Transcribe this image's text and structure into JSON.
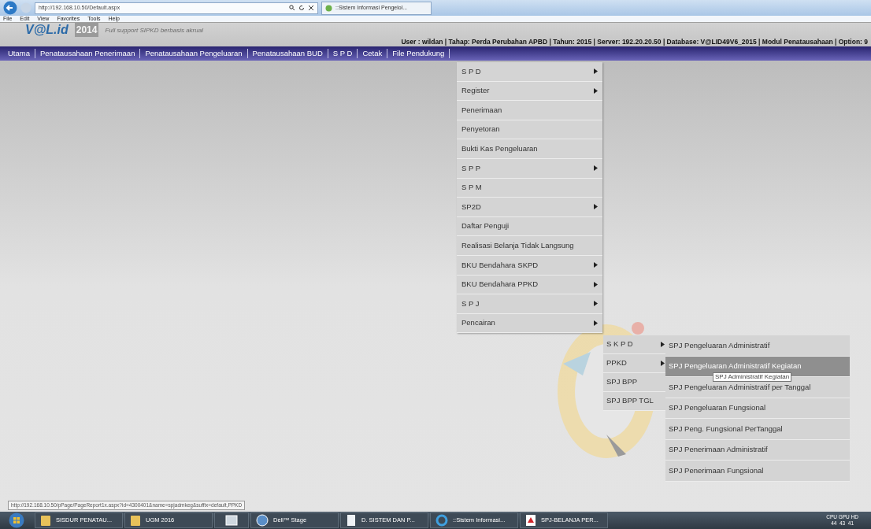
{
  "browser": {
    "address": "http://192.168.10.50/Default.aspx",
    "tab_title": "::Sistem Informasi Pengelol...",
    "menu": [
      "File",
      "Edit",
      "View",
      "Favorites",
      "Tools",
      "Help"
    ]
  },
  "header": {
    "logo": "V@L.id",
    "logo_year": "2014",
    "tagline": "Full support SIPKD berbasis akrual",
    "info": "User : wildan | Tahap: Perda Perubahan APBD | Tahun: 2015 | Server: 192.20.20.50 | Database: V@LID49V6_2015 | Modul Penatausahaan | Option: 9"
  },
  "nav": [
    "Utama",
    "Penatausahaan Penerimaan",
    "Penatausahaan Pengeluaran",
    "Penatausahaan BUD",
    "S P D",
    "Cetak",
    "File Pendukung"
  ],
  "menu": [
    {
      "label": "S P D",
      "has_submenu": true
    },
    {
      "label": "Register",
      "has_submenu": true
    },
    {
      "label": "Penerimaan",
      "has_submenu": false
    },
    {
      "label": "Penyetoran",
      "has_submenu": false
    },
    {
      "label": "Bukti Kas Pengeluaran",
      "has_submenu": false
    },
    {
      "label": "S P P",
      "has_submenu": true
    },
    {
      "label": "S P M",
      "has_submenu": false
    },
    {
      "label": "SP2D",
      "has_submenu": true
    },
    {
      "label": "Daftar Penguji",
      "has_submenu": false
    },
    {
      "label": "Realisasi Belanja Tidak Langsung",
      "has_submenu": false
    },
    {
      "label": "BKU Bendahara SKPD",
      "has_submenu": true
    },
    {
      "label": "BKU Bendahara PPKD",
      "has_submenu": true
    },
    {
      "label": "S P J",
      "has_submenu": true
    },
    {
      "label": "Pencairan",
      "has_submenu": true
    }
  ],
  "submenu": [
    {
      "label": "S K P D",
      "has_submenu": true
    },
    {
      "label": "PPKD",
      "has_submenu": true
    },
    {
      "label": "SPJ BPP",
      "has_submenu": false
    },
    {
      "label": "SPJ BPP TGL",
      "has_submenu": false
    }
  ],
  "submenu_2": [
    {
      "label": "SPJ Pengeluaran Administratif",
      "highlighted": false
    },
    {
      "label": "SPJ Pengeluaran Administratif Kegiatan",
      "highlighted": true
    },
    {
      "label": "SPJ Pengeluaran Administratif per Tanggal",
      "highlighted": false
    },
    {
      "label": "SPJ Pengeluaran Fungsional",
      "highlighted": false
    },
    {
      "label": "SPJ Peng. Fungsional PerTanggal",
      "highlighted": false
    },
    {
      "label": "SPJ Penerimaan Administratif",
      "highlighted": false
    },
    {
      "label": "SPJ Penerimaan Fungsional",
      "highlighted": false
    }
  ],
  "tooltip": "SPJ Administratif Kegiatan",
  "status_url": "http://192.168.10.50/pPage/PageReport1x.aspx?id=4300401&name=spjadmkeg&suffix=default,PPKD",
  "taskbar": [
    {
      "kind": "folder",
      "label": "SISDUR PENATAU..."
    },
    {
      "kind": "folder",
      "label": "UGM 2016"
    },
    {
      "kind": "app"
    },
    {
      "kind": "dell",
      "label": "Dell™ Stage"
    },
    {
      "kind": "doc",
      "label": "D. SISTEM DAN P..."
    },
    {
      "kind": "ie",
      "label": "::Sistem Informasi..."
    },
    {
      "kind": "pdf",
      "label": "SPJ-BELANJA PER..."
    }
  ],
  "tray": {
    "labels": "CPU GPU HD",
    "values": "44  43  41"
  }
}
